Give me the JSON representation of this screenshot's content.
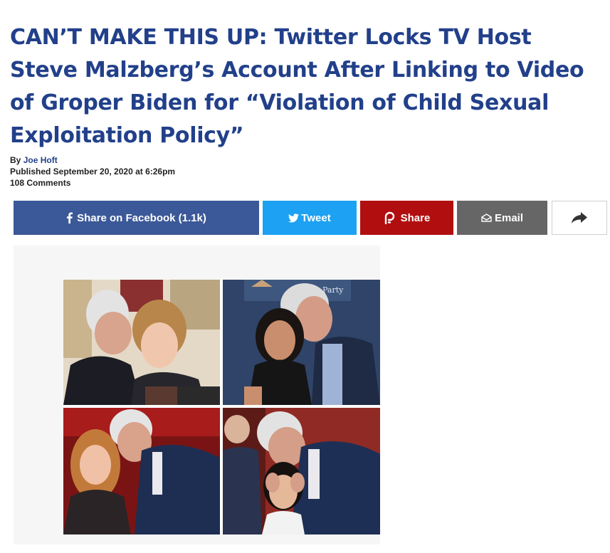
{
  "article": {
    "headline": "CAN’T MAKE THIS UP: Twitter Locks TV Host Steve Malzberg’s Account After Linking to Video of Groper Biden for “Violation of Child Sexual Exploitation Policy”",
    "byline_prefix": "By ",
    "author": "Joe Hoft",
    "published": "Published September 20, 2020 at 6:26pm",
    "comments": "108 Comments"
  },
  "share": {
    "facebook_label": "Share on Facebook (1.1k)",
    "twitter_label": "Tweet",
    "parler_label": "Share",
    "email_label": "Email",
    "icons": [
      "facebook-icon",
      "twitter-icon",
      "parler-icon",
      "envelope-icon",
      "share-arrow-icon"
    ],
    "colors": {
      "facebook": "#3b5998",
      "twitter": "#1da1f2",
      "parler": "#b10f0f",
      "email": "#666666"
    }
  },
  "photo": {
    "sign_text": "Party",
    "panels": 4
  },
  "colors": {
    "headline": "#22408a"
  }
}
